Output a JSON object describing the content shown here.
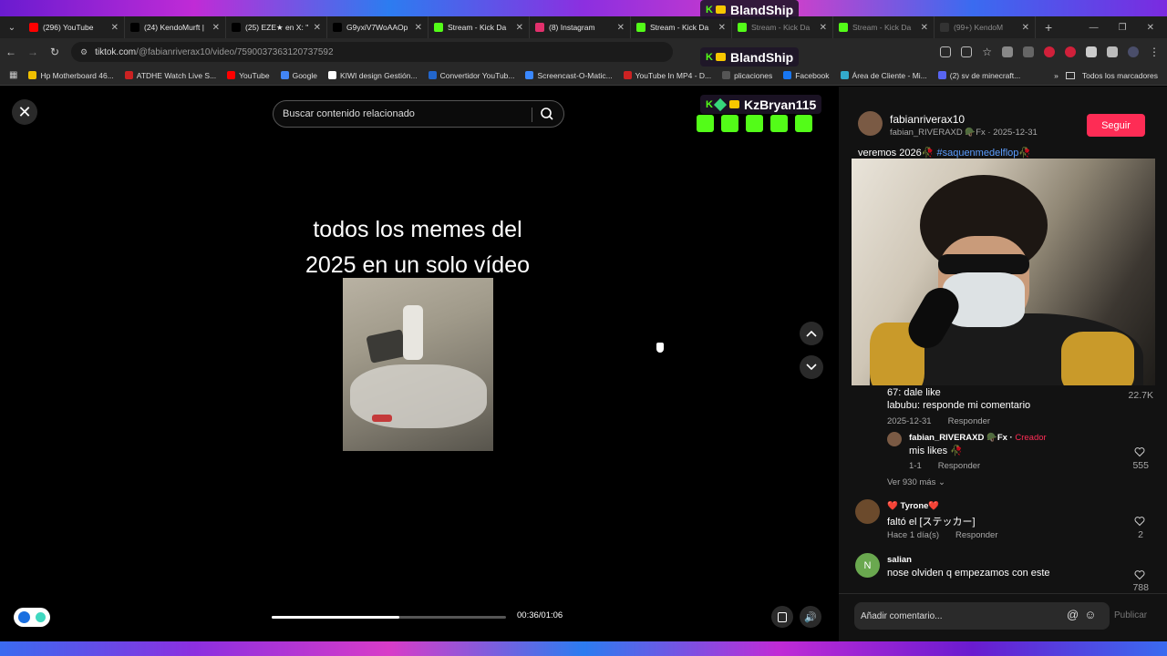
{
  "tabs": [
    {
      "label": "(296) YouTube",
      "color": "#ff0000",
      "dim": false
    },
    {
      "label": "(24) KendoMurft |",
      "color": "#000000",
      "dim": false
    },
    {
      "label": "(25) EZE★ en X: \"",
      "color": "#000000",
      "dim": false
    },
    {
      "label": "G9yxiV7WoAAOp",
      "color": "#000000",
      "dim": false
    },
    {
      "label": "Stream - Kick Da",
      "color": "#53fc18",
      "dim": false
    },
    {
      "label": "(8) Instagram",
      "color": "#e1306c",
      "dim": false
    },
    {
      "label": "Stream - Kick Da",
      "color": "#53fc18",
      "dim": false
    },
    {
      "label": "Stream - Kick Da",
      "color": "#53fc18",
      "dim": true
    },
    {
      "label": "Stream - Kick Da",
      "color": "#53fc18",
      "dim": true
    },
    {
      "label": "(99+) KendoM",
      "color": "#333333",
      "dim": true
    }
  ],
  "address": {
    "host": "tiktok.com",
    "path": "/@fabianriverax10/video/7590037363120737592"
  },
  "bookmarks": [
    {
      "label": "Hp Motherboard 46...",
      "color": "#f0c000"
    },
    {
      "label": "ATDHE Watch Live S...",
      "color": "#cc2222"
    },
    {
      "label": "YouTube",
      "color": "#ff0000"
    },
    {
      "label": "Google",
      "color": "#4285f4"
    },
    {
      "label": "KIWI design Gestión...",
      "color": "#ffffff"
    },
    {
      "label": "Convertidor YouTub...",
      "color": "#2266cc"
    },
    {
      "label": "Screencast-O-Matic...",
      "color": "#3a88ff"
    },
    {
      "label": "YouTube In MP4 - D...",
      "color": "#cc2222"
    },
    {
      "label": "plicaciones",
      "color": "#555555"
    },
    {
      "label": "Facebook",
      "color": "#1877f2"
    },
    {
      "label": "Área de Cliente - Mi...",
      "color": "#33aacc"
    },
    {
      "label": "(2) sv de minecraft...",
      "color": "#5865f2"
    }
  ],
  "bookmarks_all": "Todos los marcadores",
  "search": {
    "placeholder": "Buscar contenido relacionado"
  },
  "video": {
    "caption_line1": "todos los memes del",
    "caption_line2": "2025 en un solo vídeo",
    "time": "00:36/01:06",
    "progress": 0.545
  },
  "overlay": {
    "user1": "BlandShip",
    "user2": "BlandShip",
    "user3": "KzBryan115"
  },
  "author": {
    "name": "fabianriverax10",
    "sub": "fabian_RIVERAXD 🪖Fx · 2025-12-31",
    "follow": "Seguir"
  },
  "description": {
    "text": "veremos 2026🥀 ",
    "hashtag": "#saquenmedelflop",
    "emoji": "🥀"
  },
  "comments": {
    "c1": {
      "line1": "67: dale like",
      "line2": "labubu: responde mi comentario",
      "date": "2025-12-31",
      "reply": "Responder",
      "likes": "22.7K"
    },
    "r1": {
      "name": "fabian_RIVERAXD 🪖Fx · ",
      "creator": "Creador",
      "text": "mis likes 🥀",
      "date": "1-1",
      "reply": "Responder",
      "likes": "555"
    },
    "more": "Ver 930 más",
    "c2": {
      "name": "❤️ Tyrone❤️",
      "text": "faltó el [ステッカー]",
      "date": "Hace 1 día(s)",
      "reply": "Responder",
      "likes": "2"
    },
    "c3": {
      "name": "salian",
      "initial": "N",
      "text": "nose olviden q empezamos con este",
      "likes": "788"
    }
  },
  "compose": {
    "placeholder": "Añadir comentario...",
    "publish": "Publicar"
  },
  "colors": {
    "accent": "#fe2c55",
    "kick": "#53fc18",
    "link": "#5c9eff"
  }
}
